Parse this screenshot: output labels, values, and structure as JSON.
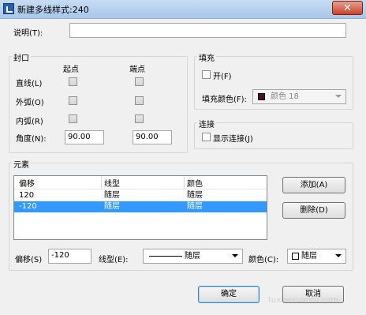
{
  "window": {
    "title": "新建多线样式:240",
    "close_glyph": "✕"
  },
  "description": {
    "label": "说明(T):",
    "value": ""
  },
  "caps": {
    "title": "封口",
    "start_header": "起点",
    "end_header": "端点",
    "rows": [
      {
        "label": "直线(L)"
      },
      {
        "label": "外弧(O)"
      },
      {
        "label": "内弧(R)"
      }
    ],
    "angle": {
      "label": "角度(N):",
      "start": "90.00",
      "end": "90.00"
    }
  },
  "fill": {
    "title": "填充",
    "on_label": "开(F)",
    "color_label": "填充颜色(F):",
    "color_value": "颜色 18",
    "swatch_color": "#4a1012"
  },
  "connect": {
    "title": "连接",
    "show_label": "显示连接(J)"
  },
  "elements": {
    "title": "元素",
    "columns": [
      "偏移",
      "线型",
      "颜色"
    ],
    "rows": [
      {
        "offset": "120",
        "linetype": "随层",
        "color": "随层",
        "selected": false
      },
      {
        "offset": "-120",
        "linetype": "随层",
        "color": "随层",
        "selected": true
      }
    ],
    "add_button": "添加(A)",
    "delete_button": "删除(D)",
    "offset_label": "偏移(S)",
    "offset_value": "-120",
    "linetype_label": "线型(E):",
    "linetype_value": "随层",
    "color_label": "颜色(C):",
    "color_value": "随层"
  },
  "buttons": {
    "ok": "确定",
    "cancel": "取消"
  },
  "watermark": "tuxiaoruantu.com"
}
